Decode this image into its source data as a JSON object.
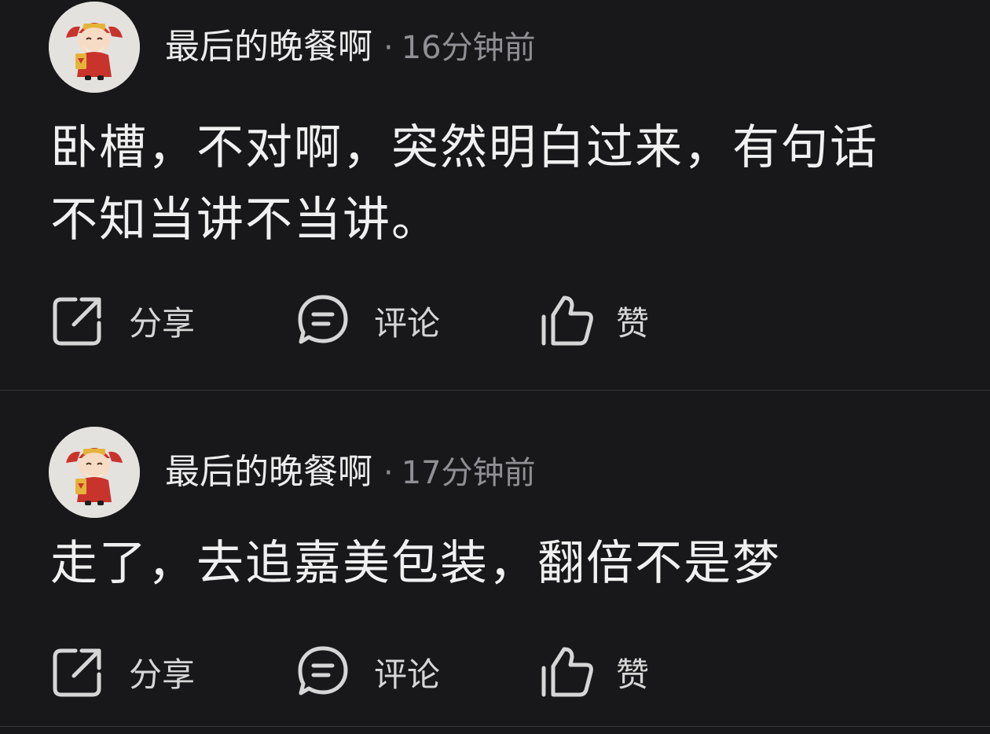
{
  "posts": [
    {
      "author": "最后的晚餐啊",
      "separator": "·",
      "time": "16分钟前",
      "content_lines": [
        "卧槽，不对啊，突然明白过来，有句话",
        "不知当讲不当讲。"
      ],
      "actions": {
        "share": "分享",
        "comment": "评论",
        "like": "赞"
      }
    },
    {
      "author": "最后的晚餐啊",
      "separator": "·",
      "time": "17分钟前",
      "content_lines": [
        "走了，去追嘉美包装，翻倍不是梦"
      ],
      "actions": {
        "share": "分享",
        "comment": "评论",
        "like": "赞"
      }
    }
  ],
  "icons": {
    "avatar": "caishen-cartoon-avatar",
    "share": "share-icon",
    "comment": "comment-icon",
    "like": "thumbs-up-icon"
  },
  "colors": {
    "background": "#18181a",
    "divider": "#34343a",
    "text_primary": "#f0f0f0",
    "text_secondary": "#8f8f95"
  }
}
